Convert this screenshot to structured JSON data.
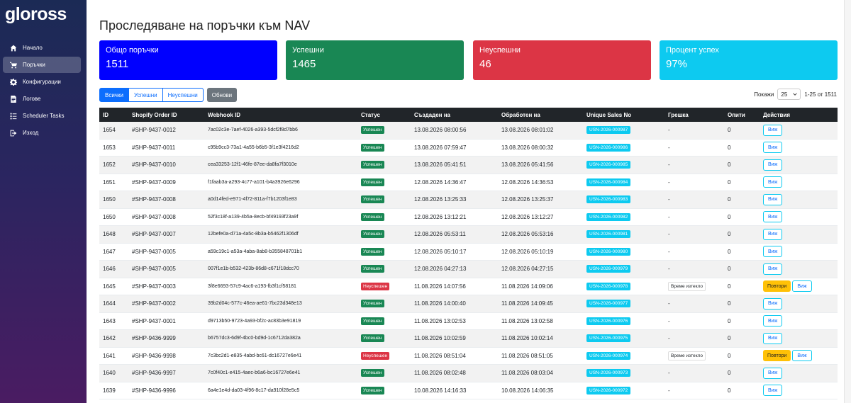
{
  "app": {
    "logo": "gloross"
  },
  "sidebar": {
    "items": [
      {
        "label": "Начало",
        "icon": "home-icon",
        "active": false
      },
      {
        "label": "Поръчки",
        "icon": "cart-icon",
        "active": true
      },
      {
        "label": "Конфигурации",
        "icon": "gear-icon",
        "active": false
      },
      {
        "label": "Логове",
        "icon": "log-icon",
        "active": false
      },
      {
        "label": "Scheduler Tasks",
        "icon": "tasks-icon",
        "active": false
      },
      {
        "label": "Изход",
        "icon": "logout-icon",
        "active": false
      }
    ]
  },
  "page": {
    "title": "Проследяване на поръчки към NAV"
  },
  "stats": [
    {
      "label": "Общо поръчки",
      "value": "1511",
      "color": "#0000ff"
    },
    {
      "label": "Успешни",
      "value": "1465",
      "color": "#198754"
    },
    {
      "label": "Неуспешни",
      "value": "46",
      "color": "#dc3545"
    },
    {
      "label": "Процент успех",
      "value": "97%",
      "color": "#0dcaf0"
    }
  ],
  "filters": {
    "all": "Всички",
    "success": "Успешни",
    "failed": "Неуспешни",
    "refresh": "Обнови"
  },
  "pager": {
    "show_label": "Покажи",
    "per_page": "25",
    "range": "1-25 от 1511"
  },
  "table": {
    "headers": [
      "ID",
      "Shopify Order ID",
      "Webhook ID",
      "Статус",
      "Създаден на",
      "Обработен на",
      "Unique Sales No",
      "Грешка",
      "Опити",
      "Действия"
    ],
    "view_label": "Виж",
    "retry_label": "Повтори",
    "rows": [
      {
        "id": "1654",
        "shopify": "#SHP-9437-0012",
        "webhook": "7ac02c3e-7aef-4026-a393-5dcf2f8d7bb6",
        "status": "Успешен",
        "ok": true,
        "created": "13.08.2026 08:00:56",
        "processed": "13.08.2026 08:01:02",
        "usn": "USN-2026-000987",
        "error": "-",
        "attempts": "0"
      },
      {
        "id": "1653",
        "shopify": "#SHP-9437-0011",
        "webhook": "c95b9cc3-73a1-4a55-b6b5-3f1e3f4216d2",
        "status": "Успешен",
        "ok": true,
        "created": "13.08.2026 07:59:47",
        "processed": "13.08.2026 08:00:32",
        "usn": "USN-2026-000986",
        "error": "-",
        "attempts": "0"
      },
      {
        "id": "1652",
        "shopify": "#SHP-9437-0010",
        "webhook": "cea33253-12f1-46fe-87ee-da8fa7f3010e",
        "status": "Успешен",
        "ok": true,
        "created": "13.08.2026 05:41:51",
        "processed": "13.08.2026 05:41:56",
        "usn": "USN-2026-000985",
        "error": "-",
        "attempts": "0"
      },
      {
        "id": "1651",
        "shopify": "#SHP-9437-0009",
        "webhook": "f1faab3a-a293-4c77-a101-b4a3926e6296",
        "status": "Успешен",
        "ok": true,
        "created": "12.08.2026 14:36:47",
        "processed": "12.08.2026 14:36:53",
        "usn": "USN-2026-000984",
        "error": "-",
        "attempts": "0"
      },
      {
        "id": "1650",
        "shopify": "#SHP-9437-0008",
        "webhook": "a0d14fed-e971-4f72-811a-f7b1203f1e83",
        "status": "Успешен",
        "ok": true,
        "created": "12.08.2026 13:25:33",
        "processed": "12.08.2026 13:25:37",
        "usn": "USN-2026-000983",
        "error": "-",
        "attempts": "0"
      },
      {
        "id": "1650",
        "shopify": "#SHP-9437-0008",
        "webhook": "52f3c18f-a139-4b5a-8ecb-bf49193f23a9f",
        "status": "Успешен",
        "ok": true,
        "created": "12.08.2026 13:12:21",
        "processed": "12.08.2026 13:12:27",
        "usn": "USN-2026-000982",
        "error": "-",
        "attempts": "0"
      },
      {
        "id": "1648",
        "shopify": "#SHP-9437-0007",
        "webhook": "12befe0a-d71a-4a5c-8b3a-b5462f1306df",
        "status": "Успешен",
        "ok": true,
        "created": "12.08.2026 05:53:11",
        "processed": "12.08.2026 05:53:16",
        "usn": "USN-2026-000981",
        "error": "-",
        "attempts": "0"
      },
      {
        "id": "1647",
        "shopify": "#SHP-9437-0005",
        "webhook": "a59c19c1-a53a-4aba-8ab8-b355848701b1",
        "status": "Успешен",
        "ok": true,
        "created": "12.08.2026 05:10:17",
        "processed": "12.08.2026 05:10:19",
        "usn": "USN-2026-000980",
        "error": "-",
        "attempts": "0"
      },
      {
        "id": "1646",
        "shopify": "#SHP-9437-0005",
        "webhook": "007f1e1b-b532-423b-86d8-c671f18dcc70",
        "status": "Успешен",
        "ok": true,
        "created": "12.08.2026 04:27:13",
        "processed": "12.08.2026 04:27:15",
        "usn": "USN-2026-000979",
        "error": "-",
        "attempts": "0"
      },
      {
        "id": "1645",
        "shopify": "#SHP-9437-0003",
        "webhook": "3f8e6693-57c9-4ac6-a193-fb3f1cf58181",
        "status": "Неуспешен",
        "ok": false,
        "created": "11.08.2026 14:07:56",
        "processed": "11.08.2026 14:09:06",
        "usn": "USN-2026-000978",
        "error": "Време изтекло",
        "attempts": "0"
      },
      {
        "id": "1644",
        "shopify": "#SHP-9437-0002",
        "webhook": "39b2d04c-577c-46ea-ae61-7bc23d348e13",
        "status": "Успешен",
        "ok": true,
        "created": "11.08.2026 14:00:40",
        "processed": "11.08.2026 14:09:45",
        "usn": "USN-2026-000977",
        "error": "-",
        "attempts": "0"
      },
      {
        "id": "1643",
        "shopify": "#SHP-9437-0001",
        "webhook": "d9713b50-9723-4a93-bf2c-ac83b3e91819",
        "status": "Успешен",
        "ok": true,
        "created": "11.08.2026 13:02:53",
        "processed": "11.08.2026 13:02:58",
        "usn": "USN-2026-000976",
        "error": "-",
        "attempts": "0"
      },
      {
        "id": "1642",
        "shopify": "#SHP-9436-9999",
        "webhook": "b6757dc3-6d9f-4bc0-bd9d-1c6712da382a",
        "status": "Успешен",
        "ok": true,
        "created": "11.08.2026 10:02:59",
        "processed": "11.08.2026 10:02:14",
        "usn": "USN-2026-000975",
        "error": "-",
        "attempts": "0"
      },
      {
        "id": "1641",
        "shopify": "#SHP-9436-9998",
        "webhook": "7c3bc2d1-e835-4abd-bc61-dc16727e6e41",
        "status": "Неуспешен",
        "ok": false,
        "created": "11.08.2026 08:51:04",
        "processed": "11.08.2026 08:51:05",
        "usn": "USN-2026-000974",
        "error": "Време изтекло",
        "attempts": "0"
      },
      {
        "id": "1640",
        "shopify": "#SHP-9436-9997",
        "webhook": "7c0f40c1-e415-4aec-b6a6-bc16727e6e41",
        "status": "Успешен",
        "ok": true,
        "created": "11.08.2026 08:02:48",
        "processed": "11.08.2026 08:03:04",
        "usn": "USN-2026-000973",
        "error": "-",
        "attempts": "0"
      },
      {
        "id": "1639",
        "shopify": "#SHP-9436-9996",
        "webhook": "6a4e1e4d-da03-4f96-8c17-da910f28e5c5",
        "status": "Успешен",
        "ok": true,
        "created": "10.08.2026 14:16:33",
        "processed": "10.08.2026 14:06:35",
        "usn": "USN-2026-000972",
        "error": "-",
        "attempts": "0"
      }
    ]
  }
}
